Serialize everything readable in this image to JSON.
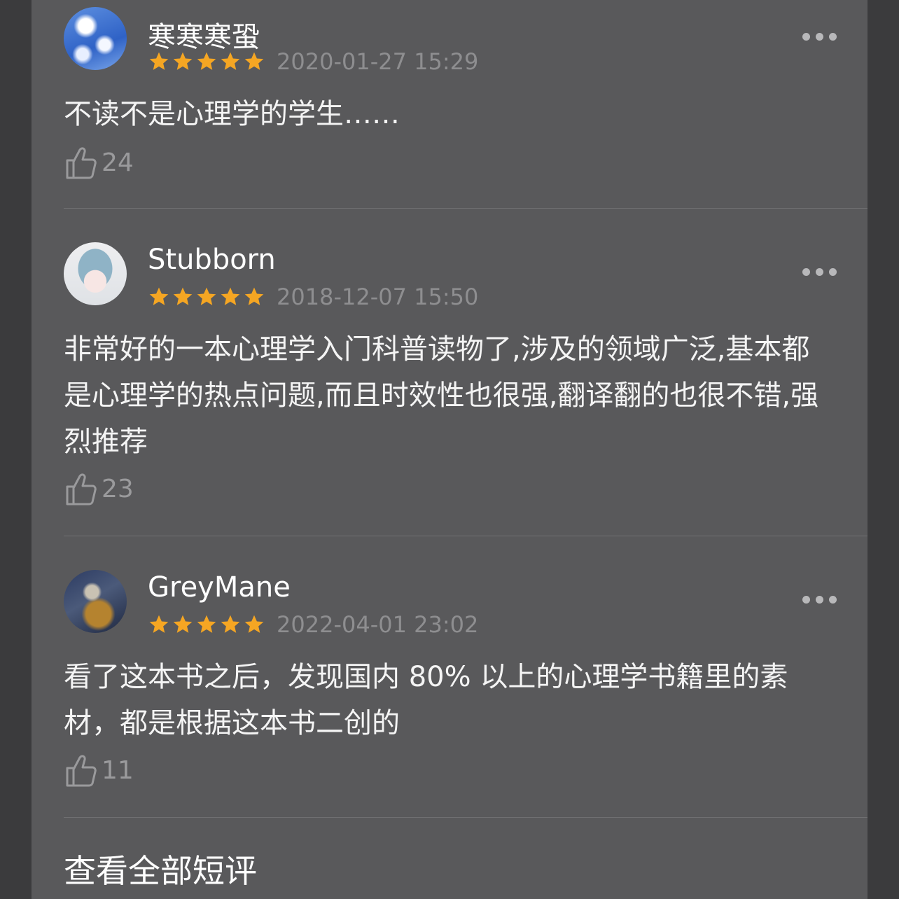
{
  "reviews": [
    {
      "username": "寒寒寒蛩",
      "avatar_icon": "sky-clouds-avatar",
      "rating": 5,
      "date": "2020-01-27 15:29",
      "content": "不读不是心理学的学生……",
      "likes": "24"
    },
    {
      "username": "Stubborn",
      "avatar_icon": "illustrated-girl-avatar",
      "rating": 5,
      "date": "2018-12-07 15:50",
      "content": "非常好的一本心理学入门科普读物了,涉及的领域广泛,基本都是心理学的热点问题,而且时效性也很强,翻译翻的也很不错,强烈推荐",
      "likes": "23"
    },
    {
      "username": "GreyMane",
      "avatar_icon": "warrior-avatar",
      "rating": 5,
      "date": "2022-04-01 23:02",
      "content": "看了这本书之后，发现国内 80% 以上的心理学书籍里的素材，都是根据这本书二创的",
      "likes": "11"
    }
  ],
  "footer": {
    "view_all_label": "查看全部短评"
  },
  "colors": {
    "star": "#f5a623",
    "card_bg": "#59595b",
    "page_bg": "#3b3b3d"
  }
}
